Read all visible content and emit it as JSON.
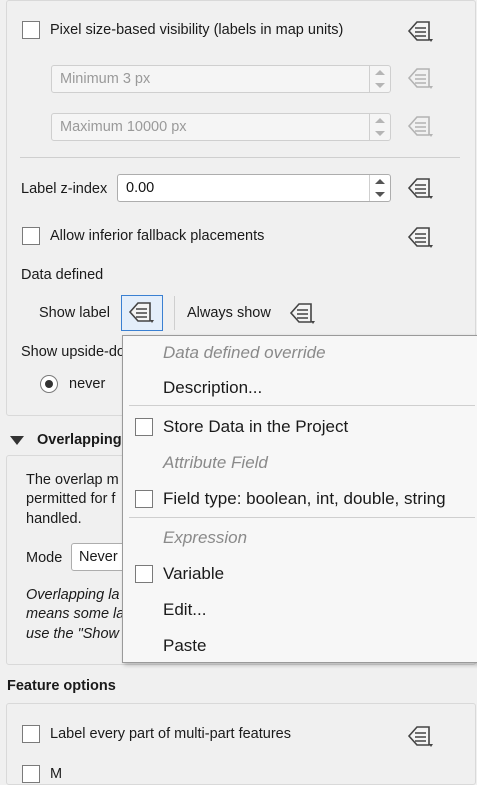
{
  "rendering": {
    "pixel_visibility_label": "Pixel size-based visibility (labels in map units)",
    "min_value": "Minimum 3 px",
    "max_value": "Maximum 10000 px",
    "zindex_label": "Label z-index",
    "zindex_value": "0.00",
    "fallback_label": "Allow inferior fallback placements",
    "data_defined_label": "Data defined",
    "show_label": "Show label",
    "always_show": "Always show",
    "show_upside_down": "Show upside-do",
    "never": "never"
  },
  "overlapping": {
    "title": "Overlapping",
    "desc_line1": "The overlap m",
    "desc_line2": "permitted for f",
    "desc_line3": "handled.",
    "mode_label": "Mode",
    "mode_value": "Never",
    "note_line1": "Overlapping la",
    "note_line2": "means some la",
    "note_line3": "use the \"Show"
  },
  "feature_options": {
    "title": "Feature options",
    "every_part_label": "Label every part of multi-part features",
    "next_label": "M"
  },
  "context_menu": {
    "header_override": "Data defined override",
    "description": "Description...",
    "store_data": "Store Data in the Project",
    "header_attribute": "Attribute Field",
    "field_type": "Field type: boolean, int, double, string",
    "header_expression": "Expression",
    "variable": "Variable",
    "edit": "Edit...",
    "paste": "Paste"
  },
  "icons": {
    "data_defined": "data-defined-override-icon",
    "collapse": "collapse-arrow-icon"
  }
}
